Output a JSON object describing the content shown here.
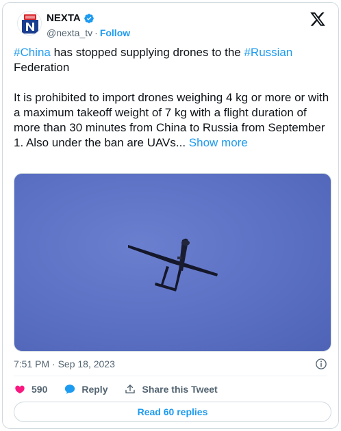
{
  "author": {
    "name": "NEXTA",
    "handle": "@nexta_tv",
    "separator": "·",
    "follow_label": "Follow"
  },
  "tweet": {
    "para1": {
      "hashtag1": "#China",
      "text1": " has stopped supplying drones to the ",
      "hashtag2": "#Russian",
      "text2": " Federation"
    },
    "para2": {
      "text": "It is prohibited to import drones weighing 4 kg or more or with a maximum takeoff weight of 7 kg with a flight duration of more than 30 minutes from China to Russia from September 1. Also under the ban are UAVs... ",
      "show_more": "Show more"
    }
  },
  "timestamp": "7:51 PM · Sep 18, 2023",
  "actions": {
    "like_count": "590",
    "reply_label": "Reply",
    "share_label": "Share this Tweet"
  },
  "read_replies_label": "Read 60 replies",
  "colors": {
    "accent": "#1d9bf0",
    "like": "#f91880",
    "text": "#0f1419",
    "muted": "#536471",
    "sky": "#5b70c3"
  },
  "icons": [
    "nexta-logo-icon",
    "verified-badge-icon",
    "x-logo-icon",
    "info-icon",
    "heart-icon",
    "reply-bubble-icon",
    "share-icon"
  ]
}
